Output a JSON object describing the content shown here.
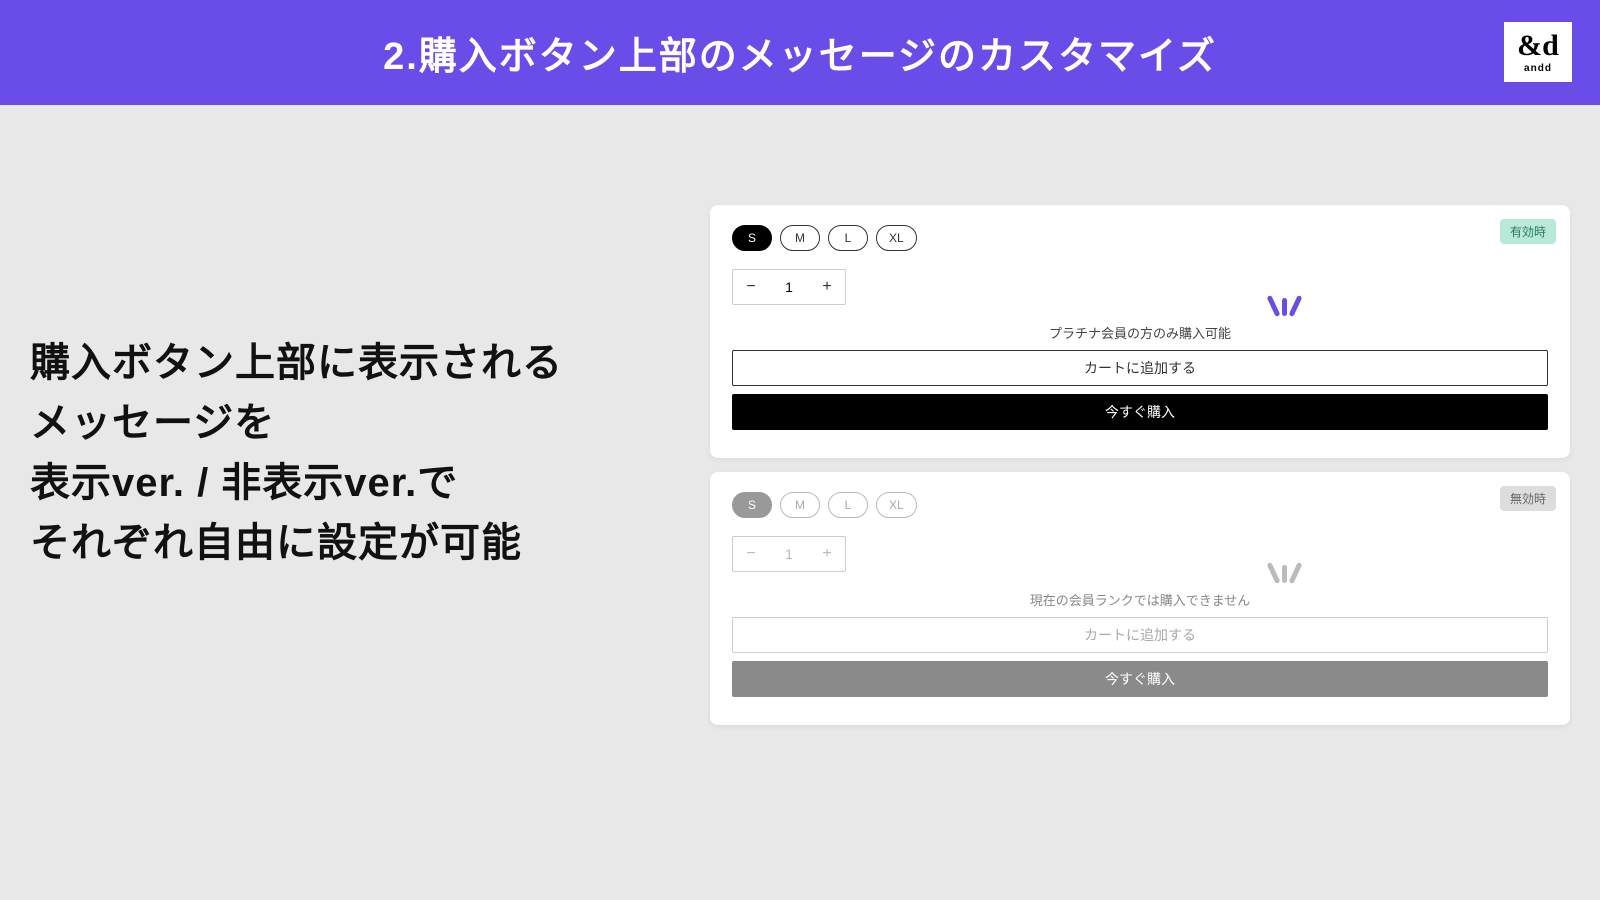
{
  "header": {
    "title": "2.購入ボタン上部のメッセージのカスタマイズ",
    "logo_main": "&d",
    "logo_sub": "andd"
  },
  "left": {
    "line1": "購入ボタン上部に表示される",
    "line2": "メッセージを",
    "line3": "表示ver. / 非表示ver.で",
    "line4": "それぞれ自由に設定が可能"
  },
  "sizes": [
    "S",
    "M",
    "L",
    "XL"
  ],
  "qty": {
    "minus": "−",
    "value": "1",
    "plus": "+"
  },
  "card_enabled": {
    "badge": "有効時",
    "message": "プラチナ会員の方のみ購入可能",
    "add_cart": "カートに追加する",
    "buy_now": "今すぐ購入"
  },
  "card_disabled": {
    "badge": "無効時",
    "message": "現在の会員ランクでは購入できません",
    "add_cart": "カートに追加する",
    "buy_now": "今すぐ購入"
  }
}
